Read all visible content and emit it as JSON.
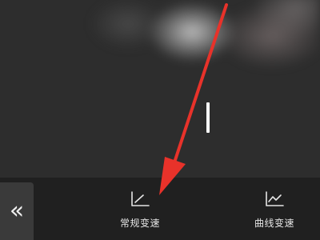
{
  "preview": {
    "thumbnail": "blurred-video-frame",
    "playhead": "white-vertical-bar"
  },
  "annotation": {
    "type": "red-arrow",
    "color": "#e8322a"
  },
  "toolbar": {
    "back_icon": "«",
    "normal_speed": {
      "label": "常规变速",
      "icon": "straight-line-chart-icon"
    },
    "curve_speed": {
      "label": "曲线变速",
      "icon": "curve-line-chart-icon"
    }
  },
  "colors": {
    "background": "#2b2b2b",
    "toolbar": "#202020",
    "text": "#e6e6e6",
    "arrow": "#e8322a"
  }
}
